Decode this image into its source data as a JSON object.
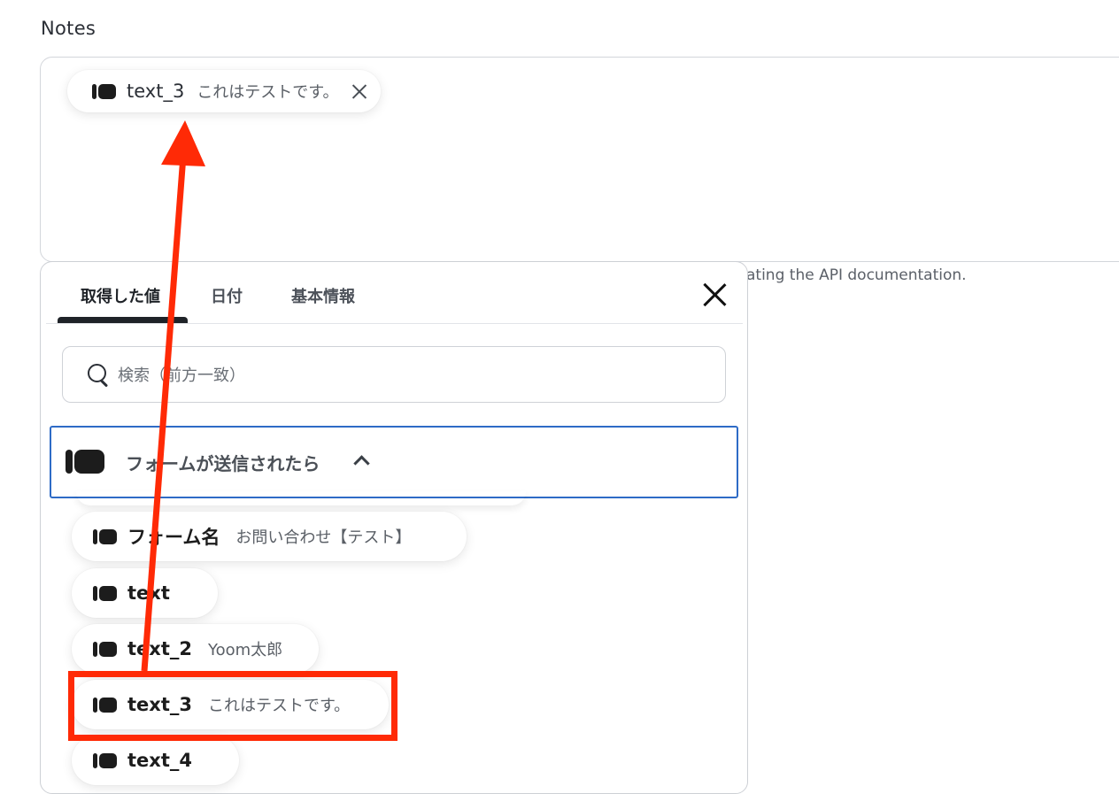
{
  "notes": {
    "label": "Notes",
    "chip": {
      "name": "text_3",
      "value": "これはテストです。"
    },
    "helper_text": "ating the API documentation."
  },
  "panel": {
    "tabs": [
      {
        "label": "取得した値",
        "active": true
      },
      {
        "label": "日付",
        "active": false
      },
      {
        "label": "基本情報",
        "active": false
      }
    ],
    "search": {
      "placeholder": "検索（前方一致）",
      "value": ""
    },
    "group": {
      "title": "フォームが送信されたら",
      "expanded": true
    },
    "items": [
      {
        "name": "フォーム名",
        "value": "お問い合わせ【テスト】"
      },
      {
        "name": "text",
        "value": ""
      },
      {
        "name": "text_2",
        "value": "Yoom太郎"
      },
      {
        "name": "text_3",
        "value": "これはテストです。",
        "highlighted": true
      },
      {
        "name": "text_4",
        "value": ""
      }
    ]
  },
  "annotation": {
    "highlight_color": "#ff2a06",
    "arrow_color": "#ff2a06"
  }
}
